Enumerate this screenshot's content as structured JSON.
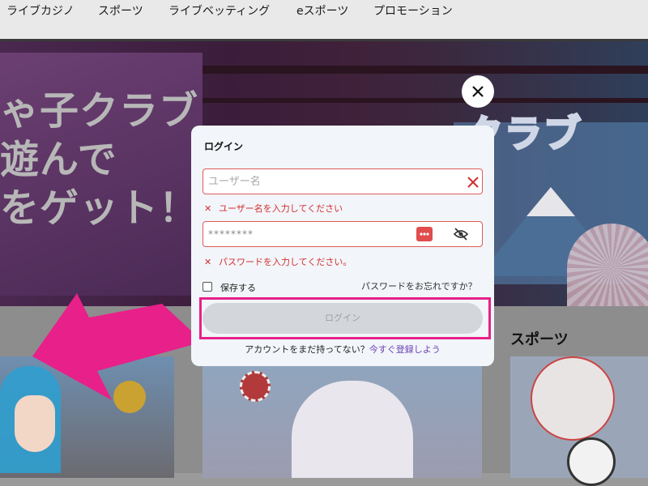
{
  "nav": {
    "items": [
      "ライブカジノ",
      "スポーツ",
      "ライブベッティング",
      "eスポーツ",
      "プロモーション"
    ]
  },
  "banner": {
    "lines": [
      "ゃ子クラブ",
      "遊んで",
      "をゲット！"
    ],
    "logo_text": "クラブ"
  },
  "sections": {
    "sports_title": "スポーツ"
  },
  "modal": {
    "title": "ログイン",
    "username_placeholder": "ユーザー名",
    "username_error": "ユーザー名を入力してください",
    "password_value": "********",
    "password_error": "パスワードを入力してください。",
    "remember_label": "保存する",
    "forgot_link": "パスワードをお忘れですか？",
    "login_button": "ログイン",
    "no_account_text": "アカウントをまだ持ってない？",
    "signup_link": "今すぐ登録しよう"
  },
  "colors": {
    "error": "#d32f2f",
    "highlight": "#e8208a",
    "link": "#6a3fb5"
  },
  "icons": [
    "close-icon",
    "clear-icon",
    "password-dots-icon",
    "eye-off-icon",
    "error-x-icon",
    "arrow-pointer"
  ]
}
